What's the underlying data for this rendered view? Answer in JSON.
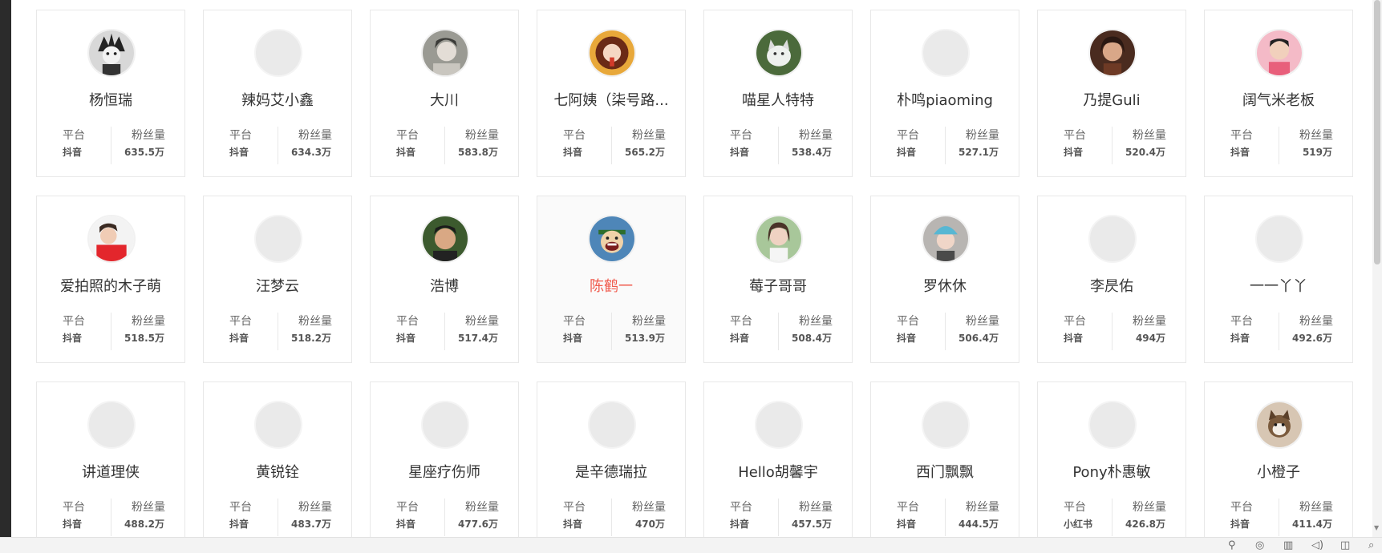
{
  "labels": {
    "platform": "平台",
    "fans": "粉丝量"
  },
  "cards": [
    {
      "name": "杨恒瑞",
      "platform": "抖音",
      "fans": "635.5万",
      "avatar": "cartoon-boy"
    },
    {
      "name": "辣妈艾小鑫",
      "platform": "抖音",
      "fans": "634.3万",
      "avatar": "empty"
    },
    {
      "name": "大川",
      "platform": "抖音",
      "fans": "583.8万",
      "avatar": "photo-gray"
    },
    {
      "name": "七阿姨（柒号路...",
      "platform": "抖音",
      "fans": "565.2万",
      "avatar": "photo-warm"
    },
    {
      "name": "喵星人特特",
      "platform": "抖音",
      "fans": "538.4万",
      "avatar": "cat-green"
    },
    {
      "name": "朴鸣piaoming",
      "platform": "抖音",
      "fans": "527.1万",
      "avatar": "empty"
    },
    {
      "name": "乃提Guli",
      "platform": "抖音",
      "fans": "520.4万",
      "avatar": "photo-brown"
    },
    {
      "name": "阔气米老板",
      "platform": "抖音",
      "fans": "519万",
      "avatar": "photo-pink"
    },
    {
      "name": "爱拍照的木子萌",
      "platform": "抖音",
      "fans": "518.5万",
      "avatar": "photo-red"
    },
    {
      "name": "汪梦云",
      "platform": "抖音",
      "fans": "518.2万",
      "avatar": "empty"
    },
    {
      "name": "浩博",
      "platform": "抖音",
      "fans": "517.4万",
      "avatar": "photo-dark"
    },
    {
      "name": "陈鹤一",
      "platform": "抖音",
      "fans": "513.9万",
      "avatar": "cartoon-pirate",
      "active": true
    },
    {
      "name": "莓子哥哥",
      "platform": "抖音",
      "fans": "508.4万",
      "avatar": "photo-light"
    },
    {
      "name": "罗休休",
      "platform": "抖音",
      "fans": "506.4万",
      "avatar": "photo-blue"
    },
    {
      "name": "李昃佑",
      "platform": "抖音",
      "fans": "494万",
      "avatar": "empty"
    },
    {
      "name": "一一丫丫",
      "platform": "抖音",
      "fans": "492.6万",
      "avatar": "empty"
    },
    {
      "name": "讲道理侠",
      "platform": "抖音",
      "fans": "488.2万",
      "avatar": "empty"
    },
    {
      "name": "黄锐铨",
      "platform": "抖音",
      "fans": "483.7万",
      "avatar": "empty"
    },
    {
      "name": "星座疗伤师",
      "platform": "抖音",
      "fans": "477.6万",
      "avatar": "empty"
    },
    {
      "name": "是辛德瑞拉",
      "platform": "抖音",
      "fans": "470万",
      "avatar": "empty"
    },
    {
      "name": "Hello胡馨宇",
      "platform": "抖音",
      "fans": "457.5万",
      "avatar": "empty"
    },
    {
      "name": "西门飘飘",
      "platform": "抖音",
      "fans": "444.5万",
      "avatar": "empty"
    },
    {
      "name": "Pony朴惠敏",
      "platform": "小红书",
      "fans": "426.8万",
      "avatar": "empty"
    },
    {
      "name": "小橙子",
      "platform": "抖音",
      "fans": "411.4万",
      "avatar": "cat-white"
    }
  ],
  "colors": {
    "active_name": "#f05a4c",
    "border": "#e8e8e8",
    "avatar_placeholder": "#eaeaea"
  },
  "tray_icons": [
    "pin-icon",
    "network-icon",
    "chip-icon",
    "speaker-icon",
    "window-icon",
    "search-icon"
  ]
}
